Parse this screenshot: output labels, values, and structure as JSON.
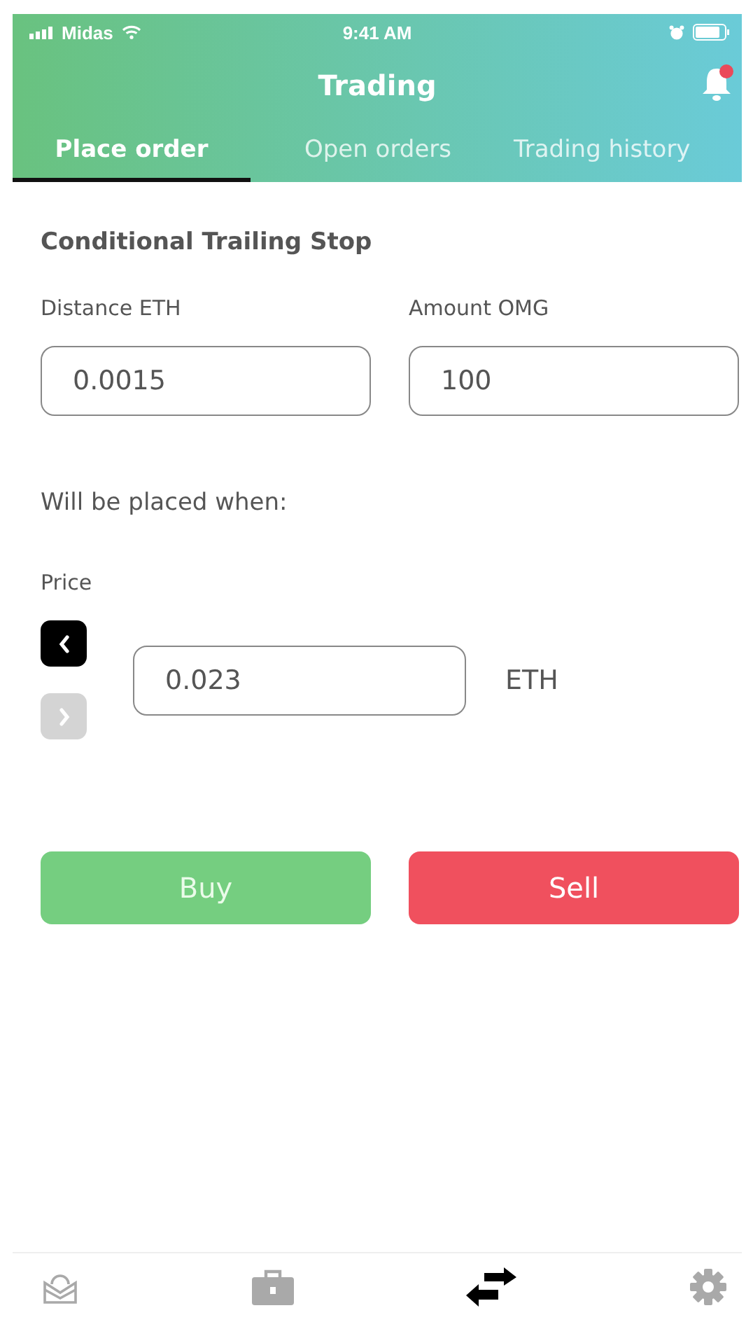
{
  "status_bar": {
    "carrier": "Midas",
    "time": "9:41 AM"
  },
  "header": {
    "title": "Trading",
    "notification": true
  },
  "tabs": [
    {
      "label": "Place order",
      "selected": true
    },
    {
      "label": "Open orders",
      "selected": false
    },
    {
      "label": "Trading history",
      "selected": false
    }
  ],
  "order": {
    "title": "Conditional Trailing Stop",
    "fields": [
      {
        "label": "Distance ETH",
        "value": "0.0015"
      },
      {
        "label": "Amount OMG",
        "value": "100"
      }
    ],
    "condition": "Will be placed when:",
    "price": {
      "label": "Price",
      "value": "0.023",
      "unit": "ETH",
      "prev": {
        "disabled": false
      },
      "next": {
        "disabled": true
      }
    }
  },
  "actions": [
    {
      "label": "Buy",
      "kind": "buy"
    },
    {
      "label": "Sell",
      "kind": "sell"
    }
  ],
  "bottom_nav": [
    {
      "kind": "stack",
      "selected": false
    },
    {
      "kind": "briefcase",
      "selected": false
    },
    {
      "kind": "exchange",
      "selected": true
    },
    {
      "kind": "gear",
      "selected": false
    }
  ]
}
